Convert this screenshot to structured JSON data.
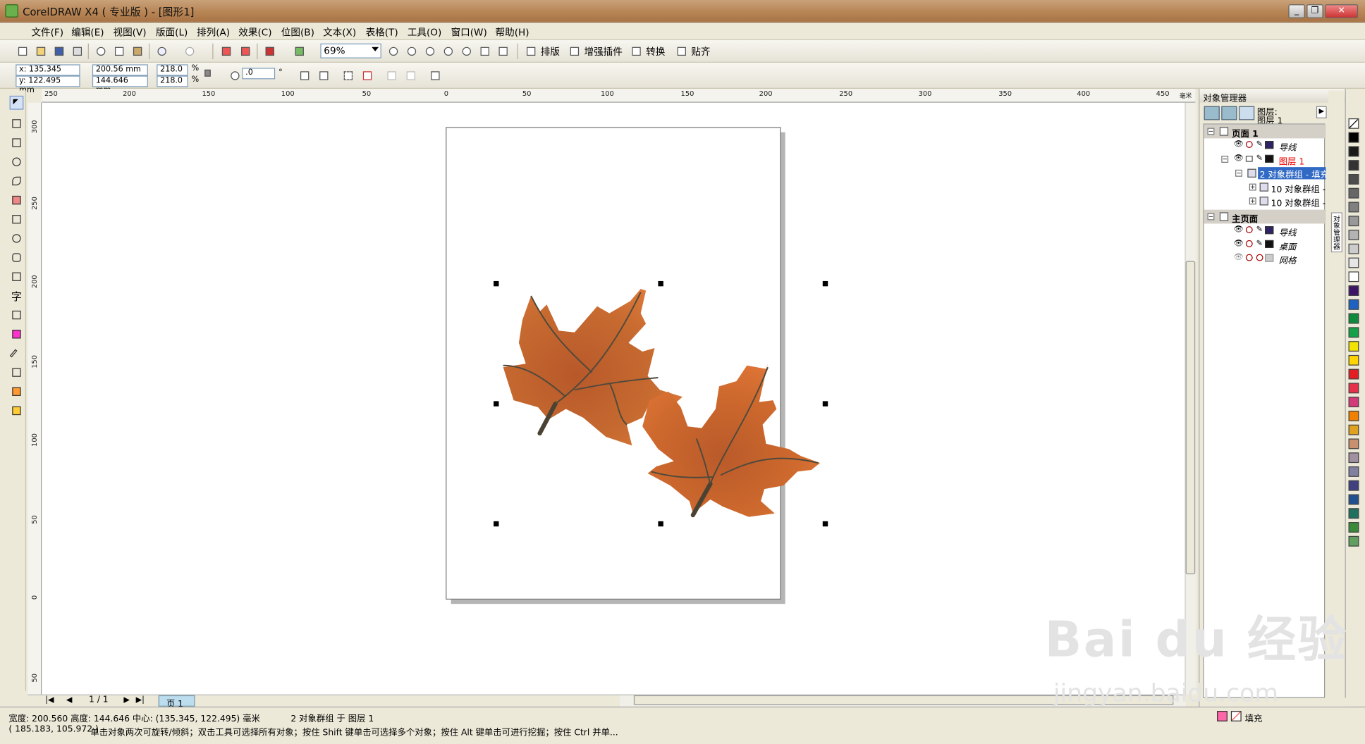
{
  "window": {
    "title": "CorelDRAW X4 ( 专业版 ) - [图形1]",
    "minimize": "_",
    "restore": "❐",
    "close": "✕"
  },
  "menubar": [
    "文件(F)",
    "编辑(E)",
    "视图(V)",
    "版面(L)",
    "排列(A)",
    "效果(C)",
    "位图(B)",
    "文本(X)",
    "表格(T)",
    "工具(O)",
    "窗口(W)",
    "帮助(H)"
  ],
  "toolbar": {
    "zoom": "69%",
    "buttons": [
      "排版",
      "增强插件",
      "转换",
      "贴齐"
    ]
  },
  "propbar": {
    "x": "x: 135.345 mm",
    "y": "y: 122.495 mm",
    "width": "200.56 mm",
    "height": "144.646 mm",
    "scale_w": "218.0",
    "scale_h": "218.0",
    "pct": "%",
    "rotation": ".0",
    "deg": "°"
  },
  "ruler_top": [
    "250",
    "200",
    "150",
    "100",
    "50",
    "0",
    "50",
    "100",
    "150",
    "200",
    "250",
    "300",
    "350",
    "400",
    "450",
    "毫米"
  ],
  "ruler_left": [
    "300",
    "250",
    "200",
    "150",
    "100",
    "50",
    "0",
    "50"
  ],
  "pagenav": {
    "counter": "1 / 1",
    "tab": "页 1"
  },
  "status": {
    "line1": "宽度: 200.560  高度: 144.646  中心: (135.345, 122.495)  毫米",
    "selection": "2 对象群组 于 图层 1",
    "coords": "( 185.183, 105.972 )",
    "hint": "单击对象两次可旋转/倾斜；双击工具可选择所有对象；按住 Shift 键单击可选择多个对象；按住 Alt 键单击可进行挖掘；按住 Ctrl 并单...",
    "fill": "填充"
  },
  "docker": {
    "title": "对象管理器",
    "layer_header": "图层:",
    "layer_name": "图层 1",
    "rows": [
      {
        "label": "页面 1",
        "bold": true
      },
      {
        "label": "导线",
        "italic": true,
        "color": "#2c2466"
      },
      {
        "label": "图层 1",
        "red": true,
        "color": "#111"
      },
      {
        "label": "2 对象群组 - 填充",
        "selected": true
      },
      {
        "label": "10 对象群组 -"
      },
      {
        "label": "10 对象群组 -"
      },
      {
        "label": "主页面",
        "bold": true
      },
      {
        "label": "导线",
        "italic": true,
        "color": "#2c2466"
      },
      {
        "label": "桌面",
        "italic": true,
        "color": "#111"
      },
      {
        "label": "网格",
        "italic": true,
        "color": "#bbb"
      }
    ],
    "side_tabs": "对象管理器"
  },
  "palette": [
    "#000000",
    "#1a1a1a",
    "#333333",
    "#4d4d4d",
    "#666666",
    "#808080",
    "#999999",
    "#b3b3b3",
    "#cccccc",
    "#e6e6e6",
    "#ffffff",
    "#3d1466",
    "#1f62c2",
    "#0e8a3c",
    "#15a04a",
    "#f2e400",
    "#ffd400",
    "#e21d24",
    "#e5324a",
    "#d23a7a",
    "#f08000",
    "#e0a020",
    "#c89070",
    "#a090a0",
    "#8080a0",
    "#404080",
    "#205090",
    "#207060",
    "#3a8a3a",
    "#60a060"
  ],
  "watermark": {
    "brand": "Bai du 经验",
    "url": "jingyan.baidu.com"
  }
}
